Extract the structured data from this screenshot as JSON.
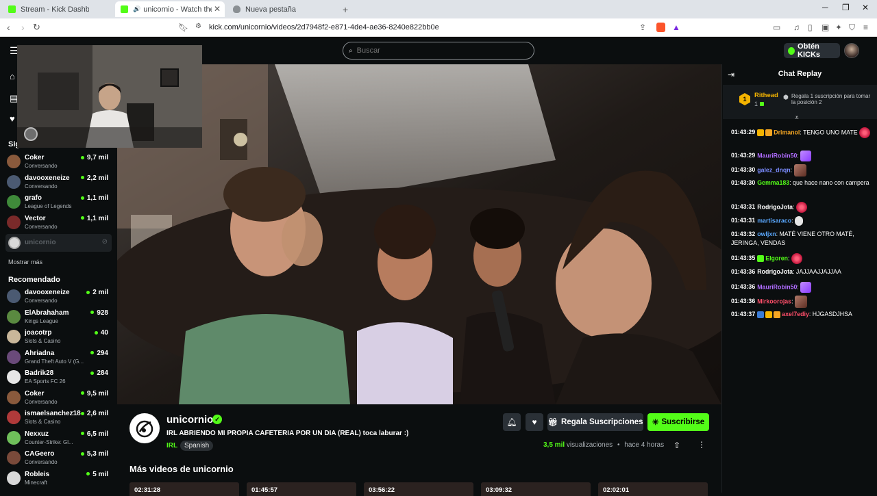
{
  "browser": {
    "tabs": [
      {
        "title": "Stream - Kick Dashboard"
      },
      {
        "title": "unicornio - Watch the VOD on Kick"
      },
      {
        "title": "Nueva pestaña"
      }
    ],
    "url": "kick.com/unicornio/videos/2d7948f2-e871-4de4-ae36-8240e822bb0e"
  },
  "topnav": {
    "search_placeholder": "Buscar",
    "get_kicks": "Obtén KICKs"
  },
  "sidebar": {
    "following_title": "Sig",
    "following": [
      {
        "name": "Coker",
        "category": "Conversando",
        "viewers": "9,7 mil",
        "color": "#8a5a3c"
      },
      {
        "name": "davooxeneize",
        "category": "Conversando",
        "viewers": "2,2 mil",
        "color": "#4b5a72"
      },
      {
        "name": "grafo",
        "category": "League of Legends",
        "viewers": "1,1 mil",
        "color": "#3f8a3a"
      },
      {
        "name": "Vector",
        "category": "Conversando",
        "viewers": "1,1 mil",
        "color": "#7a2a2a"
      }
    ],
    "offline": {
      "name": "unicornio"
    },
    "show_more": "Mostrar más",
    "recommended_title": "Recomendado",
    "recommended": [
      {
        "name": "davooxeneize",
        "category": "Conversando",
        "viewers": "2 mil",
        "color": "#4b5a72"
      },
      {
        "name": "ElAbrahaham",
        "category": "Kings League",
        "viewers": "928",
        "color": "#5a8a40"
      },
      {
        "name": "joacotrp",
        "category": "Slots & Casino",
        "viewers": "40",
        "color": "#c9b79a"
      },
      {
        "name": "Ahriadna",
        "category": "Grand Theft Auto V (G...",
        "viewers": "294",
        "color": "#6a4a7a"
      },
      {
        "name": "Badrik28",
        "category": "EA Sports FC 26",
        "viewers": "284",
        "color": "#e6e6e6"
      },
      {
        "name": "Coker",
        "category": "Conversando",
        "viewers": "9,5 mil",
        "color": "#8a5a3c"
      },
      {
        "name": "ismaelsanchez18",
        "category": "Slots & Casino",
        "viewers": "2,6 mil",
        "color": "#b03a3a"
      },
      {
        "name": "Nexxuz",
        "category": "Counter-Strike: Gl...",
        "viewers": "6,5 mil",
        "color": "#6fbf5a"
      },
      {
        "name": "CAGeero",
        "category": "Conversando",
        "viewers": "5,3 mil",
        "color": "#7a4a3a"
      },
      {
        "name": "Robleis",
        "category": "Minecraft",
        "viewers": "5 mil",
        "color": "#d9d9d9"
      }
    ]
  },
  "channel": {
    "name": "unicornio",
    "title": "IRL ABRIENDO MI PROPIA CAFETERIA POR UN DIA (REAL) toca laburar :)",
    "category": "IRL",
    "language": "Spanish",
    "gift_label": "Regala Suscripciones",
    "subscribe_label": "Suscribirse",
    "views_count": "3,5 mil",
    "views_label": "visualizaciones",
    "age": "hace 4 horas",
    "more_videos_title": "Más videos de unicornio",
    "video_durations": [
      "02:31:28",
      "01:45:57",
      "03:56:22",
      "03:09:32",
      "02:02:01"
    ]
  },
  "chat": {
    "title": "Chat Replay",
    "pinned": {
      "rank": "1",
      "name": "Rithead",
      "count": "1",
      "hint": "Regala 1 suscripción para tomar la posición 2"
    },
    "messages": [
      {
        "time": "01:43:29",
        "user": "Drimanol",
        "color": "#f5a623",
        "text": ": TENGO UNO MATE",
        "badges": [
          "#f5b400",
          "#f5a623"
        ],
        "emote": "e-red"
      },
      {
        "time": "01:43:29",
        "user": "MauriRobin50",
        "color": "#b06cff",
        "text": ":",
        "badges": [],
        "emote": "e-purple"
      },
      {
        "time": "01:43:30",
        "user": "galez_dnqn",
        "color": "#7b8cff",
        "text": ":",
        "badges": [],
        "emote": "e-pic"
      },
      {
        "time": "01:43:30",
        "user": "Gemma183",
        "color": "#53fc18",
        "text": ": que hace nano con campera",
        "badges": [],
        "emote": ""
      },
      {
        "time": "01:43:31",
        "user": "RodrigoJota",
        "color": "#ffffff",
        "text": ":",
        "badges": [],
        "emote": "e-red"
      },
      {
        "time": "01:43:31",
        "user": "martisaraco",
        "color": "#5aa8ff",
        "text": ":",
        "badges": [],
        "emote": "e-white"
      },
      {
        "time": "01:43:32",
        "user": "owljxn",
        "color": "#5aa8ff",
        "text": ": MATÉ VIENE OTRO MATÉ, JERINGA, VENDAS",
        "badges": [],
        "emote": ""
      },
      {
        "time": "01:43:35",
        "user": "Elgoren",
        "color": "#53fc18",
        "text": ":",
        "badges": [
          "#53fc18"
        ],
        "emote": "e-red"
      },
      {
        "time": "01:43:36",
        "user": "RodrigoJota",
        "color": "#ffffff",
        "text": ": JAJJAAJJAJJAA",
        "badges": [],
        "emote": ""
      },
      {
        "time": "01:43:36",
        "user": "MauriRobin50",
        "color": "#b06cff",
        "text": ":",
        "badges": [],
        "emote": "e-purple"
      },
      {
        "time": "01:43:36",
        "user": "Mirkoorojas",
        "color": "#ff4f6a",
        "text": ":",
        "badges": [],
        "emote": "e-pic"
      },
      {
        "time": "01:43:37",
        "user": "axel7ediy",
        "color": "#ff4f6a",
        "text": ": HJGASDJHSA",
        "badges": [
          "#3a7bd5",
          "#f5b400",
          "#f5a623"
        ],
        "emote": ""
      }
    ]
  },
  "colors": {
    "accent": "#53fc18",
    "bg": "#0b0e0f",
    "panel": "#2a3036"
  }
}
